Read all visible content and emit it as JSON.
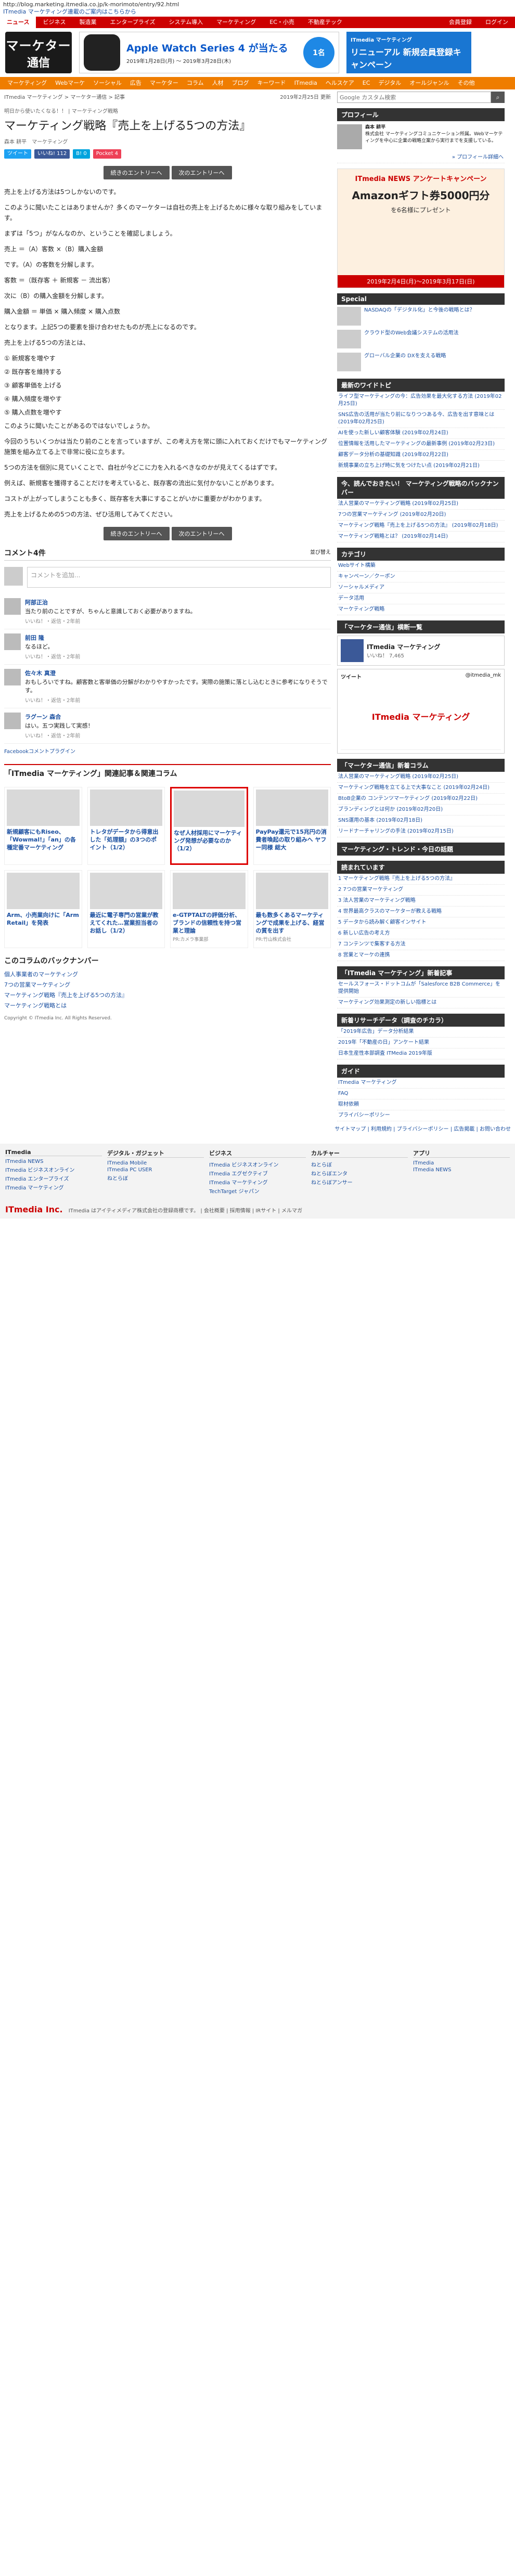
{
  "url": "http://blog.marketing.itmedia.co.jp/k-morimoto/entry/92.html",
  "url_sub": "ITmedia マーケティング連載のご案内はこちらから",
  "topnav": [
    "ニュース",
    "ビジネス",
    "製造業",
    "エンタープライズ",
    "システム導入",
    "マーケティング",
    "EC・小売",
    "不動産テック"
  ],
  "topnav_right": [
    "会員登録",
    "ログイン"
  ],
  "logo": {
    "l1": "マーケター",
    "l2": "通信"
  },
  "ad1": {
    "t1": "Apple Watch Series 4 が当たる",
    "t2": "2019年1月28日(月) ～ 2019年3月28日(木)",
    "badge": "1名"
  },
  "ad2": {
    "t1": "ITmedia マーケティング",
    "t2": "リニューアル 新規会員登録キャンペーン"
  },
  "catnav": [
    "マーケティング",
    "Webマーケ",
    "ソーシャル",
    "広告",
    "マーケター",
    "コラム",
    "人材",
    "ブログ",
    "キーワード",
    "ITmedia",
    "ヘルスケア",
    "EC",
    "デジタル",
    "オールジャンル",
    "その他"
  ],
  "crumbs": {
    "path": "ITmedia マーケティング > マーケター通信 > 記事",
    "date": "2019年2月25日 更新"
  },
  "kicker": "明日から使いたくなる！！ | マーケティング戦略",
  "title": "マーケティング戦略『売上を上げる5つの方法』",
  "meta": {
    "author": "森本 耕平",
    "tags": "マーケティング"
  },
  "social": {
    "tw": "ツイート",
    "fb": "いいね! 112",
    "hb": "B! 0",
    "pk": "Pocket 4"
  },
  "pager": [
    "続きのエントリーへ",
    "次のエントリーへ"
  ],
  "paras": [
    "売上を上げる方法は5つしかないのです。",
    "このように聞いたことはありませんか？多くのマーケターは自社の売上を上げるために様々な取り組みをしています。",
    "まずは「5つ」がなんなのか、ということを確認しましょう。",
    "売上 ＝（A）客数 ×（B）購入金額",
    "です。（A）の客数を分解します。",
    "客数 ＝（既存客 ＋ 新規客 － 流出客）",
    "次に（B）の購入金額を分解します。",
    "購入金額 ＝ 単価 × 購入頻度 × 購入点数",
    "となります。上記5つの要素を掛け合わせたものが売上になるのです。",
    "売上を上げる5つの方法とは、"
  ],
  "list": [
    "① 新規客を増やす",
    "② 既存客を維持する",
    "③ 顧客単価を上げる",
    "④ 購入頻度を増やす",
    "⑤ 購入点数を増やす"
  ],
  "paras2": [
    "このように聞いたことがあるのではないでしょうか。",
    "今回のうちいくつかは当たり前のことを言っていますが、この考え方を常に頭に入れておくだけでもマーケティング施策を組み立てる上で非常に役に立ちます。",
    "5つの方法を個別に見ていくことで、自社が今どこに力を入れるべきなのかが見えてくるはずです。",
    "例えば、新規客を獲得することだけを考えていると、既存客の流出に気付かないことがあります。",
    "コストが上がってしまうことも多く、既存客を大事にすることがいかに重要かがわかります。",
    "売上を上げるための5つの方法、ぜひ活用してみてください。"
  ],
  "comments": {
    "title": "コメント4件",
    "sort": "並び替え",
    "placeholder": "コメントを追加...",
    "items": [
      {
        "name": "阿部正治",
        "text": "当たり前のことですが、ちゃんと意識しておく必要がありますね。",
        "act": "いいね！・返信・2年前"
      },
      {
        "name": "前田 隆",
        "text": "なるほど。",
        "act": "いいね！・返信・2年前"
      },
      {
        "name": "佐々木 真澄",
        "text": "おもしろいですね。顧客数と客単価の分解がわかりやすかったです。実際の施策に落とし込むときに参考になりそうです。",
        "act": "いいね！・返信・2年前"
      },
      {
        "name": "ラグーン 森合",
        "text": "はい。五つ実践して実感！",
        "act": "いいね！・返信・2年前"
      }
    ],
    "plugin": "Facebookコメントプラグイン"
  },
  "related": {
    "title": "「ITmedia マーケティング」関連記事＆関連コラム",
    "cards": [
      {
        "title": "新規顧客にもRiseo、「Wowmal!」「an」の各種定番マーケティング",
        "sp": ""
      },
      {
        "title": "トレタがデータから得意出した「処理額」の3つのポイント（1/2）",
        "sp": ""
      },
      {
        "title": "なぜ人材採用にマーケティング発想が必要なのか（1/2）",
        "sp": ""
      },
      {
        "title": "PayPay還元で15兆円の消費者喚起の取り組みへ ヤフー同様 総大",
        "sp": ""
      },
      {
        "title": "Arm、小売業向けに「Arm Retail」を発表",
        "sp": ""
      },
      {
        "title": "最近に電子専門の営業が教えてくれた…営業担当者のお話し（1/2）",
        "sp": ""
      },
      {
        "title": "e-GTPTALTの評価分析、ブランドの信頼性を持つ営業と理論",
        "sp": "PR:カメラ事業部"
      },
      {
        "title": "最も数多くあるマーケティングで成果を上げる、経営の質を出す",
        "sp": "PR:竹山株式会社"
      }
    ]
  },
  "backnum": {
    "title": "このコラムのバックナンバー",
    "items": [
      "個人事業者のマーケティング",
      "7つの営業マーケティング",
      "マーケティング戦略『売上を上げる5つの方法』",
      "マーケティング戦略とは"
    ]
  },
  "copyright": "Copyright © ITmedia Inc. All Rights Reserved.",
  "side": {
    "search_placeholder": "Google カスタム検索",
    "profile_h": "プロフィール",
    "profile_name": "森本 耕平",
    "profile_text": "株式会社 マーケティングコミュニケーション所属。Webマーケティングを中心に企業の戦略立案から実行までを支援している。",
    "profile_link": "» プロフィール詳細へ",
    "ad": {
      "t1": "ITmedia NEWS アンケートキャンペーン",
      "t2": "Amazonギフト券5000円分",
      "t3": "を6名様にプレゼント",
      "t4": "2019年2月4日(月)～2019年3月17日(日)"
    },
    "special_h": "Special",
    "special": [
      "NASDAQの「デジタル化」と今後の戦略とは？",
      "クラウド型のWeb会議システムの活用法",
      "グローバル企業の DXを支える戦略"
    ],
    "news_h": "最新のワイドトピ",
    "news": [
      "ライフ型マーケティングの今：広告効果を最大化する方法 (2019年02月25日)",
      "SNS広告の活用が当たり前になりつつある今、広告を出す意味とは (2019年02月25日)",
      "AIを使った新しい顧客体験 (2019年02月24日)",
      "位置情報を活用したマーケティングの最新事例 (2019年02月23日)",
      "顧客データ分析の基礎知識 (2019年02月22日)",
      "新規事業の立ち上げ時に気をつけたい点 (2019年02月21日)"
    ],
    "popular_h": "今、読んでおきたい！ マーケティング戦略のバックナンバー",
    "popular": [
      "法人営業のマーケティング戦略 (2019年02月25日)",
      "7つの営業マーケティング (2019年02月20日)",
      "マーケティング戦略『売上を上げる5つの方法』 (2019年02月18日)",
      "マーケティング戦略とは？ (2019年02月14日)"
    ],
    "cat_h": "カテゴリ",
    "cats": [
      "Webサイト構築",
      "キャンペーン／クーポン",
      "ソーシャルメディア",
      "データ活用",
      "マーケティング戦略"
    ],
    "fb_h": "「マーケター通信」横断一覧",
    "fb_name": "ITmedia マーケティング",
    "fb_likes": "いいね！ 7,465",
    "tw_h": "ツイート",
    "tw_handle": "@itmedia_mk",
    "tw_brand": "ITmedia マーケティング",
    "rank_h": "「マーケター通信」新着コラム",
    "rank": [
      "法人営業のマーケティング戦略 (2019年02月25日)",
      "マーケティング戦略を立てる上で大事なこと (2019年02月24日)",
      "BtoB企業の コンテンツマーケティング (2019年02月22日)",
      "ブランディングとは何か (2019年02月20日)",
      "SNS運用の基本 (2019年02月18日)",
      "リードナーチャリングの手法 (2019年02月15日)"
    ],
    "trend_h": "マーケティング・トレンド・今日の話題",
    "read_h": "読まれています",
    "read": [
      "1 マーケティング戦略『売上を上げる5つの方法』",
      "2 7つの営業マーケティング",
      "3 法人営業のマーケティング戦略",
      "4 世界最高クラスのマーケターが教える戦略",
      "5 データから読み解く顧客インサイト",
      "6 新しい広告の考え方",
      "7 コンテンツで集客する方法",
      "8 営業とマーケの連携"
    ],
    "itm_h": "「ITmedia マーケティング」新着記事",
    "itm": [
      "セールスフォース・ドットコムが「Salesforce B2B Commerce」を提供開始",
      "マーケティング効果測定の新しい指標とは"
    ],
    "wide_h": "新着リサーチデータ（調査のチカラ）",
    "wide": [
      "「2019年広告」データ分析結果",
      "2019年「不動産の日」アンケート結果",
      "日本生産性本部調査 ITMedia 2019年版"
    ],
    "guide_h": "ガイド",
    "guide": [
      "ITmedia マーケティング",
      "FAQ",
      "取材依頼",
      "プライバシーポリシー"
    ]
  },
  "sitemap": "サイトマップ | 利用規約 | プライバシーポリシー | 広告掲載 | お問い合わせ",
  "footer": [
    {
      "h": "ITmedia",
      "items": [
        "ITmedia NEWS",
        "ITmedia ビジネスオンライン",
        "ITmedia エンタープライズ",
        "ITmedia マーケティング"
      ]
    },
    {
      "h": "デジタル・ガジェット",
      "items": [
        "ITmedia Mobile",
        "ITmedia PC USER",
        "ねとらぼ"
      ]
    },
    {
      "h": "ビジネス",
      "items": [
        "ITmedia ビジネスオンライン",
        "ITmedia エグゼクティブ",
        "ITmedia マーケティング",
        "TechTarget ジャパン"
      ]
    },
    {
      "h": "カルチャー",
      "items": [
        "ねとらぼ",
        "ねとらぼエンタ",
        "ねとらぼアンサー"
      ]
    },
    {
      "h": "アプリ",
      "items": [
        "ITmedia",
        "ITmedia NEWS"
      ]
    }
  ],
  "bottom": {
    "logo": "ITmedia Inc.",
    "text": "ITmedia はアイティメディア株式会社の登録商標です。 | 会社概要 | 採用情報 | IRサイト | メルマガ"
  }
}
